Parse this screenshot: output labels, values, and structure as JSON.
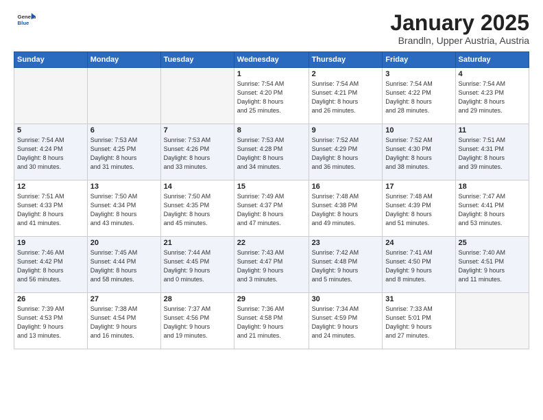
{
  "logo": {
    "general": "General",
    "blue": "Blue"
  },
  "title": "January 2025",
  "location": "Brandln, Upper Austria, Austria",
  "days_header": [
    "Sunday",
    "Monday",
    "Tuesday",
    "Wednesday",
    "Thursday",
    "Friday",
    "Saturday"
  ],
  "weeks": [
    [
      {
        "day": "",
        "info": ""
      },
      {
        "day": "",
        "info": ""
      },
      {
        "day": "",
        "info": ""
      },
      {
        "day": "1",
        "info": "Sunrise: 7:54 AM\nSunset: 4:20 PM\nDaylight: 8 hours\nand 25 minutes."
      },
      {
        "day": "2",
        "info": "Sunrise: 7:54 AM\nSunset: 4:21 PM\nDaylight: 8 hours\nand 26 minutes."
      },
      {
        "day": "3",
        "info": "Sunrise: 7:54 AM\nSunset: 4:22 PM\nDaylight: 8 hours\nand 28 minutes."
      },
      {
        "day": "4",
        "info": "Sunrise: 7:54 AM\nSunset: 4:23 PM\nDaylight: 8 hours\nand 29 minutes."
      }
    ],
    [
      {
        "day": "5",
        "info": "Sunrise: 7:54 AM\nSunset: 4:24 PM\nDaylight: 8 hours\nand 30 minutes."
      },
      {
        "day": "6",
        "info": "Sunrise: 7:53 AM\nSunset: 4:25 PM\nDaylight: 8 hours\nand 31 minutes."
      },
      {
        "day": "7",
        "info": "Sunrise: 7:53 AM\nSunset: 4:26 PM\nDaylight: 8 hours\nand 33 minutes."
      },
      {
        "day": "8",
        "info": "Sunrise: 7:53 AM\nSunset: 4:28 PM\nDaylight: 8 hours\nand 34 minutes."
      },
      {
        "day": "9",
        "info": "Sunrise: 7:52 AM\nSunset: 4:29 PM\nDaylight: 8 hours\nand 36 minutes."
      },
      {
        "day": "10",
        "info": "Sunrise: 7:52 AM\nSunset: 4:30 PM\nDaylight: 8 hours\nand 38 minutes."
      },
      {
        "day": "11",
        "info": "Sunrise: 7:51 AM\nSunset: 4:31 PM\nDaylight: 8 hours\nand 39 minutes."
      }
    ],
    [
      {
        "day": "12",
        "info": "Sunrise: 7:51 AM\nSunset: 4:33 PM\nDaylight: 8 hours\nand 41 minutes."
      },
      {
        "day": "13",
        "info": "Sunrise: 7:50 AM\nSunset: 4:34 PM\nDaylight: 8 hours\nand 43 minutes."
      },
      {
        "day": "14",
        "info": "Sunrise: 7:50 AM\nSunset: 4:35 PM\nDaylight: 8 hours\nand 45 minutes."
      },
      {
        "day": "15",
        "info": "Sunrise: 7:49 AM\nSunset: 4:37 PM\nDaylight: 8 hours\nand 47 minutes."
      },
      {
        "day": "16",
        "info": "Sunrise: 7:48 AM\nSunset: 4:38 PM\nDaylight: 8 hours\nand 49 minutes."
      },
      {
        "day": "17",
        "info": "Sunrise: 7:48 AM\nSunset: 4:39 PM\nDaylight: 8 hours\nand 51 minutes."
      },
      {
        "day": "18",
        "info": "Sunrise: 7:47 AM\nSunset: 4:41 PM\nDaylight: 8 hours\nand 53 minutes."
      }
    ],
    [
      {
        "day": "19",
        "info": "Sunrise: 7:46 AM\nSunset: 4:42 PM\nDaylight: 8 hours\nand 56 minutes."
      },
      {
        "day": "20",
        "info": "Sunrise: 7:45 AM\nSunset: 4:44 PM\nDaylight: 8 hours\nand 58 minutes."
      },
      {
        "day": "21",
        "info": "Sunrise: 7:44 AM\nSunset: 4:45 PM\nDaylight: 9 hours\nand 0 minutes."
      },
      {
        "day": "22",
        "info": "Sunrise: 7:43 AM\nSunset: 4:47 PM\nDaylight: 9 hours\nand 3 minutes."
      },
      {
        "day": "23",
        "info": "Sunrise: 7:42 AM\nSunset: 4:48 PM\nDaylight: 9 hours\nand 5 minutes."
      },
      {
        "day": "24",
        "info": "Sunrise: 7:41 AM\nSunset: 4:50 PM\nDaylight: 9 hours\nand 8 minutes."
      },
      {
        "day": "25",
        "info": "Sunrise: 7:40 AM\nSunset: 4:51 PM\nDaylight: 9 hours\nand 11 minutes."
      }
    ],
    [
      {
        "day": "26",
        "info": "Sunrise: 7:39 AM\nSunset: 4:53 PM\nDaylight: 9 hours\nand 13 minutes."
      },
      {
        "day": "27",
        "info": "Sunrise: 7:38 AM\nSunset: 4:54 PM\nDaylight: 9 hours\nand 16 minutes."
      },
      {
        "day": "28",
        "info": "Sunrise: 7:37 AM\nSunset: 4:56 PM\nDaylight: 9 hours\nand 19 minutes."
      },
      {
        "day": "29",
        "info": "Sunrise: 7:36 AM\nSunset: 4:58 PM\nDaylight: 9 hours\nand 21 minutes."
      },
      {
        "day": "30",
        "info": "Sunrise: 7:34 AM\nSunset: 4:59 PM\nDaylight: 9 hours\nand 24 minutes."
      },
      {
        "day": "31",
        "info": "Sunrise: 7:33 AM\nSunset: 5:01 PM\nDaylight: 9 hours\nand 27 minutes."
      },
      {
        "day": "",
        "info": ""
      }
    ]
  ]
}
